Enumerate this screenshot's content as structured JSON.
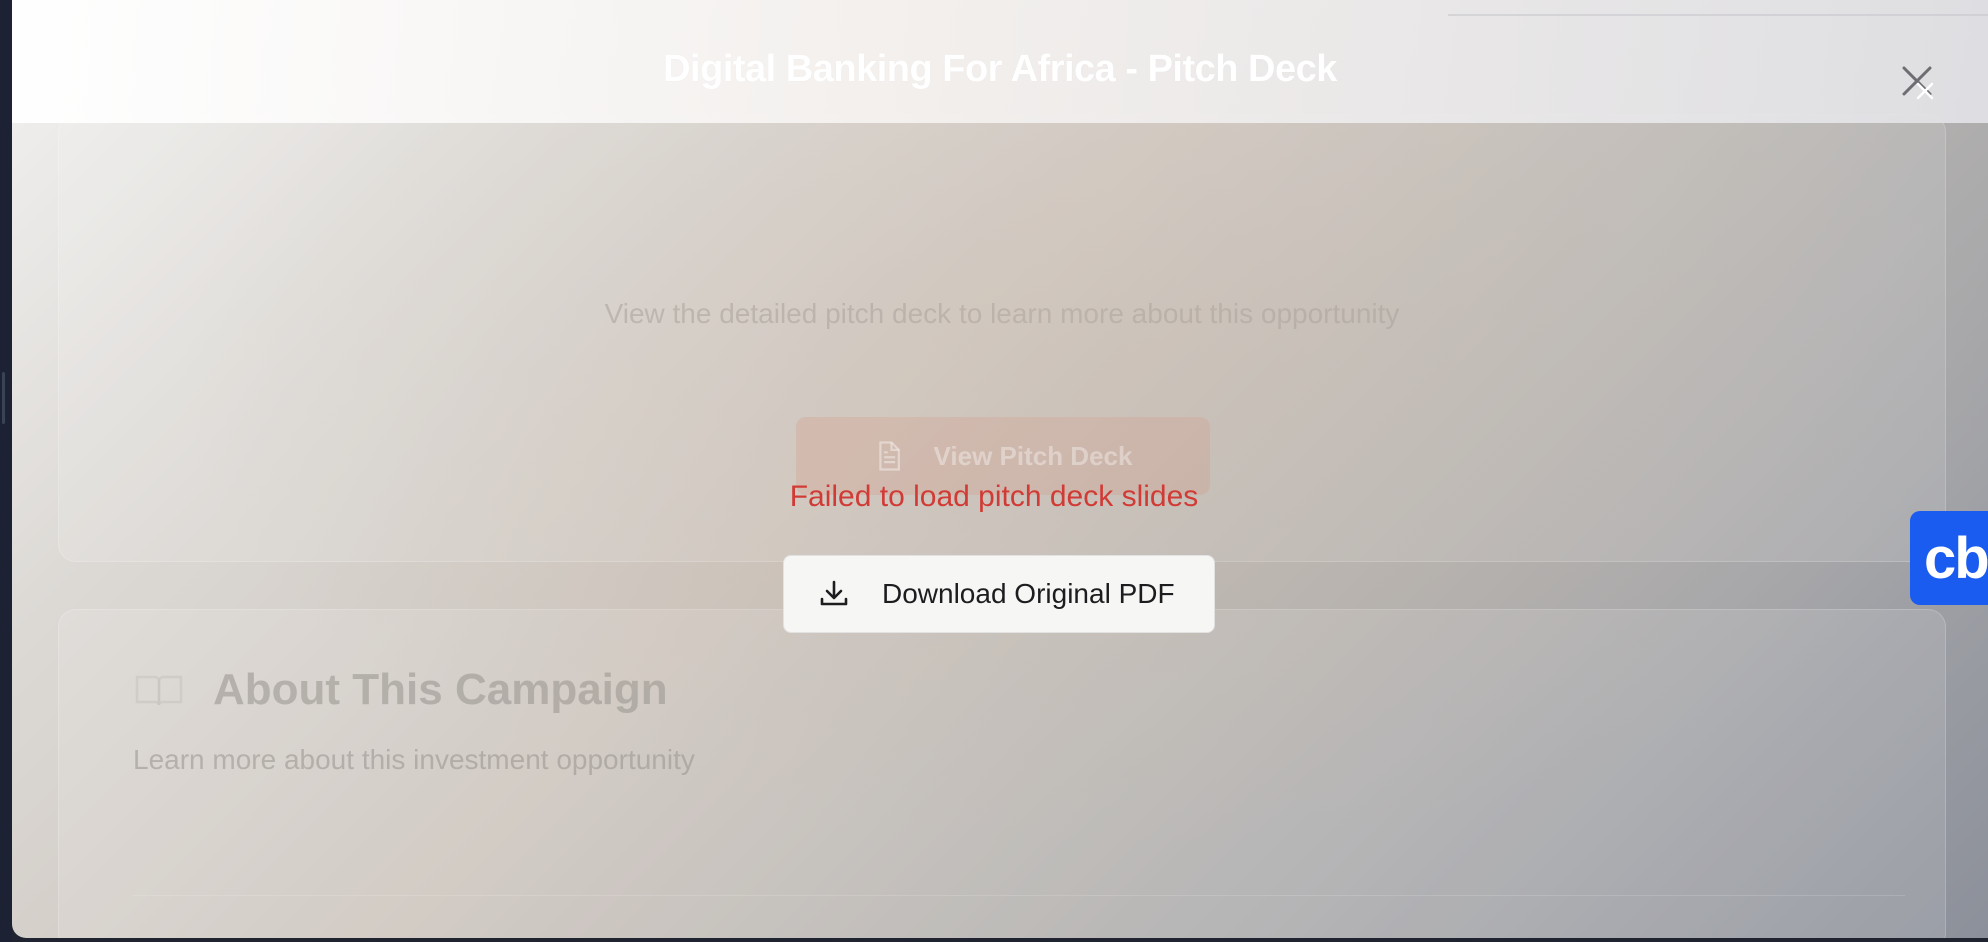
{
  "modal": {
    "title": "Digital Banking For Africa - Pitch Deck",
    "close_icon": "close-icon"
  },
  "pitch_card": {
    "description": "View the detailed pitch deck to learn more about this opportunity",
    "view_button_label": "View Pitch Deck",
    "view_button_icon": "document-icon"
  },
  "about_card": {
    "icon": "book-icon",
    "title": "About This Campaign",
    "subtitle": "Learn more about this investment opportunity"
  },
  "error": {
    "message": "Failed to load pitch deck slides"
  },
  "download": {
    "label": "Download Original PDF",
    "icon": "download-icon"
  },
  "badge": {
    "text": "cb",
    "color": "#1a5cf0"
  },
  "colors": {
    "error": "#d13b36",
    "title": "#ffffff"
  }
}
